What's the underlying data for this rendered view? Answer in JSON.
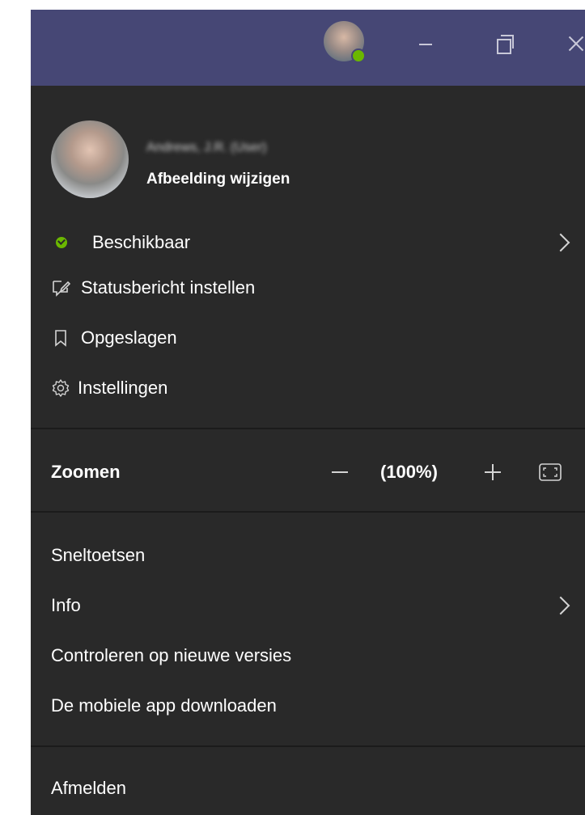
{
  "profile": {
    "name": "Andrews, J.R. (User)",
    "change_picture": "Afbeelding wijzigen"
  },
  "menu": {
    "status": "Beschikbaar",
    "status_message": "Statusbericht instellen",
    "saved": "Opgeslagen",
    "settings": "Instellingen"
  },
  "zoom": {
    "label": "Zoomen",
    "value": "(100%)"
  },
  "more": {
    "shortcuts": "Sneltoetsen",
    "info": "Info",
    "check_updates": "Controleren op nieuwe versies",
    "mobile_app": "De mobiele app downloaden"
  },
  "signout": "Afmelden",
  "colors": {
    "titlebar": "#464775",
    "menu_background": "#292929",
    "available": "#6bb700"
  },
  "icons": {
    "presence": "check-circle-icon",
    "status_message": "edit-message-icon",
    "saved": "bookmark-icon",
    "settings": "gear-icon",
    "zoom_fit": "fit-screen-icon"
  }
}
